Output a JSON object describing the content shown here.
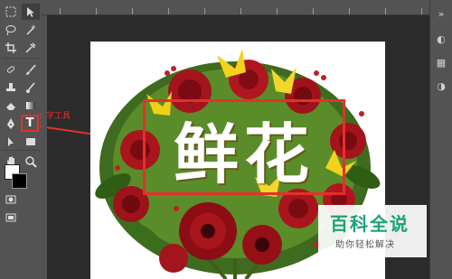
{
  "tools": {
    "text_tool_label": "T",
    "callout_label": "文字工具"
  },
  "canvas": {
    "headline": "鲜花"
  },
  "watermark": {
    "title": "百科全说",
    "subtitle": "助你轻松解决"
  },
  "colors": {
    "highlight": "#e3312a",
    "panel": "#535353",
    "workspace": "#2b2b2b",
    "brand": "#1aa37a"
  },
  "icons": [
    "marquee-icon",
    "move-icon",
    "lasso-icon",
    "magic-wand-icon",
    "crop-icon",
    "eyedropper-icon",
    "healing-brush-icon",
    "brush-icon",
    "clone-stamp-icon",
    "history-brush-icon",
    "eraser-icon",
    "gradient-icon",
    "blur-icon",
    "dodge-icon",
    "pen-icon",
    "text-icon",
    "path-selection-icon",
    "rectangle-icon",
    "hand-icon",
    "zoom-icon",
    "foreground-color-icon",
    "background-color-icon",
    "quick-mask-icon",
    "screen-mode-icon"
  ]
}
